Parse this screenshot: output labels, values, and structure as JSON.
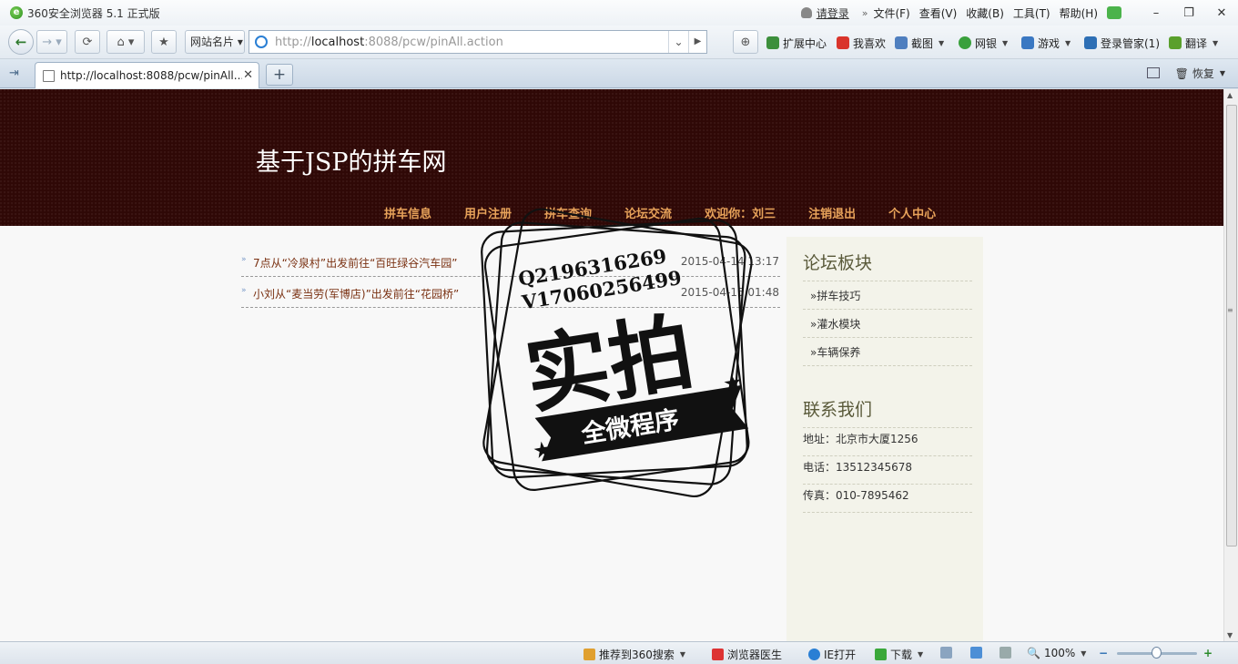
{
  "window": {
    "title": "360安全浏览器 5.1 正式版",
    "login_label": "请登录",
    "menu": [
      "文件(F)",
      "查看(V)",
      "收藏(B)",
      "工具(T)",
      "帮助(H)"
    ],
    "controls": {
      "minimize": "–",
      "restore": "❐",
      "close": "✕"
    }
  },
  "toolbar": {
    "site_card_label": "网站名片",
    "address_prefix": "http://",
    "address_host": "localhost",
    "address_rest": ":8088/pcw/pinAll.action",
    "tools": [
      {
        "label": "扩展中心",
        "color": "#3c8f3c"
      },
      {
        "label": "我喜欢",
        "color": "#d9342b"
      },
      {
        "label": "截图",
        "color": "#4f7fbf"
      },
      {
        "label": "网银",
        "color": "#39a03c"
      },
      {
        "label": "游戏",
        "color": "#3a78c2"
      },
      {
        "label": "登录管家(1)",
        "color": "#2d6fb5"
      },
      {
        "label": "翻译",
        "color": "#5aa02c"
      }
    ]
  },
  "tabs": {
    "active_title": "http://localhost:8088/pcw/pinAll....",
    "new_tab": "+",
    "restore_label": "恢复"
  },
  "site": {
    "title": "基于JSP的拼车网",
    "nav": [
      "拼车信息",
      "用户注册",
      "拼车查询",
      "论坛交流",
      "欢迎你：刘三",
      "注销退出",
      "个人中心"
    ],
    "posts": [
      {
        "title": "7点从“冷泉村”出发前往“百旺绿谷汽车园”",
        "date": "2015-04-14 13:17"
      },
      {
        "title": "小刘从“麦当劳(军博店)”出发前往“花园桥”",
        "date": "2015-04-15 01:48"
      }
    ],
    "sidebar": {
      "forum_heading": "论坛板块",
      "forum_links": [
        "»拼车技巧",
        "»灌水模块",
        "»车辆保养"
      ],
      "contact_heading": "联系我们",
      "contact_lines": [
        "地址：北京市大厦1256",
        "电话：13512345678",
        "传真：010-7895462"
      ]
    }
  },
  "watermark": {
    "line1": "Q2196316269",
    "line2": "V17060256499",
    "big": "实拍",
    "banner": "全微程序"
  },
  "status": {
    "search_label": "推荐到360搜索",
    "doctor_label": "浏览器医生",
    "ie_label": "IE打开",
    "download_label": "下载",
    "zoom": "100%",
    "zoom_minus": "−",
    "zoom_plus": "+"
  }
}
